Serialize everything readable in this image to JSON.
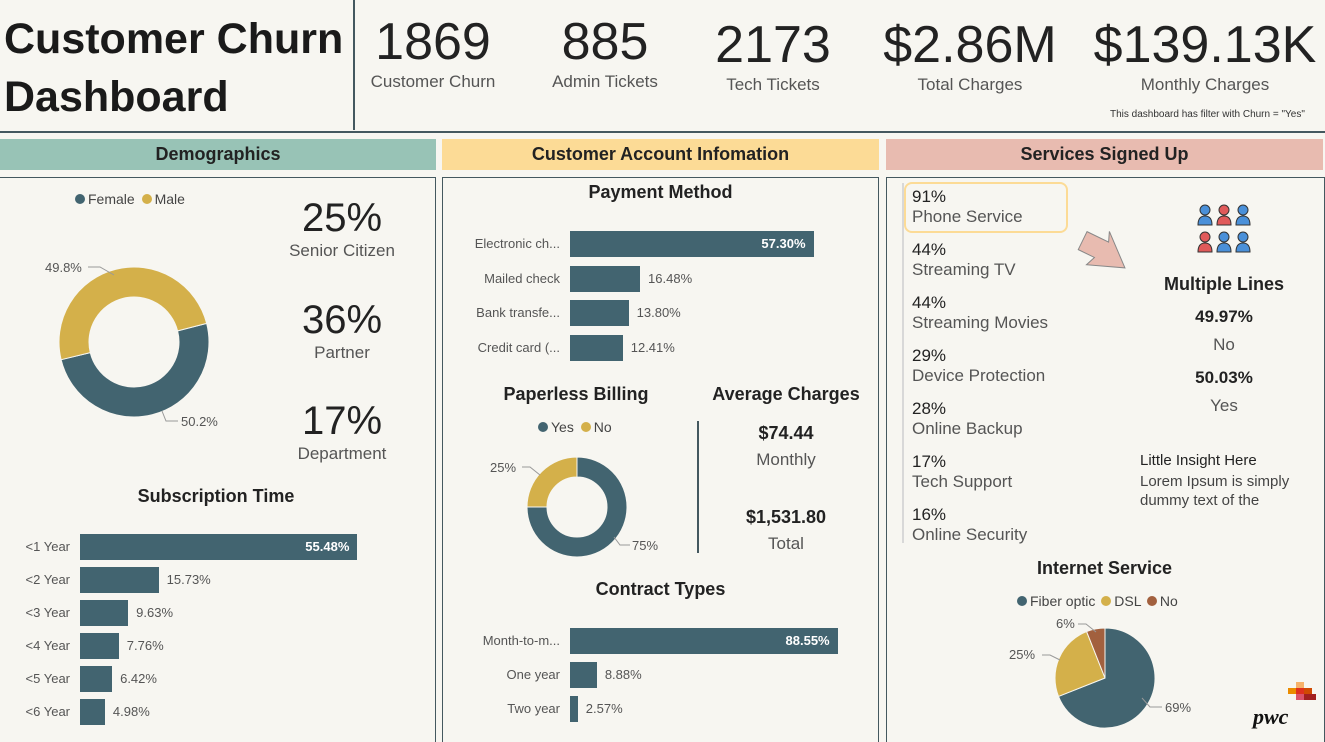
{
  "header": {
    "title_line1": "Customer Churn",
    "title_line2": "Dashboard",
    "kpis": [
      {
        "value": "1869",
        "label": "Customer Churn"
      },
      {
        "value": "885",
        "label": "Admin Tickets"
      },
      {
        "value": "2173",
        "label": "Tech Tickets"
      },
      {
        "value": "$2.86M",
        "label": "Total Charges"
      },
      {
        "value": "$139.13K",
        "label": "Monthly Charges"
      }
    ],
    "filter_note": "This dashboard has filter with Churn = \"Yes\""
  },
  "sections": {
    "demographics": "Demographics",
    "account": "Customer Account Infomation",
    "services": "Services Signed Up"
  },
  "colors": {
    "teal": "#426470",
    "gold": "#d4b04a",
    "brown": "#a2603e",
    "demographics_bg": "#98c3b6",
    "account_bg": "#fcdb96",
    "services_bg": "#e8bbb0"
  },
  "demographics": {
    "legend": [
      "Female",
      "Male"
    ],
    "gender_labels": [
      "49.8%",
      "50.2%"
    ],
    "stats": [
      {
        "value": "25%",
        "label": "Senior Citizen"
      },
      {
        "value": "36%",
        "label": "Partner"
      },
      {
        "value": "17%",
        "label": "Department"
      }
    ],
    "subscription_title": "Subscription Time"
  },
  "account": {
    "payment_title": "Payment Method",
    "paperless_title": "Paperless Billing",
    "paperless_legend": [
      "Yes",
      "No"
    ],
    "paperless_labels": [
      "25%",
      "75%"
    ],
    "avg_title": "Average Charges",
    "avg_monthly": "$74.44",
    "avg_monthly_label": "Monthly",
    "avg_total": "$1,531.80",
    "avg_total_label": "Total",
    "contract_title": "Contract Types"
  },
  "services": {
    "items": [
      {
        "pct": "91%",
        "label": "Phone Service"
      },
      {
        "pct": "44%",
        "label": "Streaming TV"
      },
      {
        "pct": "44%",
        "label": "Streaming Movies"
      },
      {
        "pct": "29%",
        "label": "Device Protection"
      },
      {
        "pct": "28%",
        "label": "Online Backup"
      },
      {
        "pct": "17%",
        "label": "Tech Support"
      },
      {
        "pct": "16%",
        "label": "Online Security"
      }
    ],
    "multiple_lines_title": "Multiple Lines",
    "ml_no_pct": "49.97%",
    "ml_no_label": "No",
    "ml_yes_pct": "50.03%",
    "ml_yes_label": "Yes",
    "insight_title": "Little Insight Here",
    "insight_line1": "Lorem Ipsum is simply",
    "insight_line2": "dummy text of the",
    "internet_title": "Internet Service",
    "internet_legend": [
      "Fiber optic",
      "DSL",
      "No"
    ],
    "internet_labels": [
      "6%",
      "25%",
      "69%"
    ],
    "brand": "pwc"
  },
  "chart_data": [
    {
      "type": "pie",
      "categories": [
        "Female",
        "Male"
      ],
      "values": [
        50.2,
        49.8
      ]
    },
    {
      "type": "bar",
      "title": "Subscription Time",
      "categories": [
        "<1 Year",
        "<2 Year",
        "<3 Year",
        "<4 Year",
        "<5 Year",
        "<6 Year"
      ],
      "values": [
        55.48,
        15.73,
        9.63,
        7.76,
        6.42,
        4.98
      ],
      "labels": [
        "55.48%",
        "15.73%",
        "9.63%",
        "7.76%",
        "6.42%",
        "4.98%"
      ],
      "xlim": [
        0,
        60
      ]
    },
    {
      "type": "bar",
      "title": "Payment Method",
      "categories": [
        "Electronic ch...",
        "Mailed check",
        "Bank transfe...",
        "Credit card (..."
      ],
      "values": [
        57.3,
        16.48,
        13.8,
        12.41
      ],
      "labels": [
        "57.30%",
        "16.48%",
        "13.80%",
        "12.41%"
      ],
      "xlim": [
        0,
        60
      ]
    },
    {
      "type": "pie",
      "title": "Paperless Billing",
      "categories": [
        "Yes",
        "No"
      ],
      "values": [
        75,
        25
      ]
    },
    {
      "type": "bar",
      "title": "Contract Types",
      "categories": [
        "Month-to-m...",
        "One year",
        "Two year"
      ],
      "values": [
        88.55,
        8.88,
        2.57
      ],
      "labels": [
        "88.55%",
        "8.88%",
        "2.57%"
      ],
      "xlim": [
        0,
        90
      ]
    },
    {
      "type": "pie",
      "title": "Internet Service",
      "categories": [
        "Fiber optic",
        "DSL",
        "No"
      ],
      "values": [
        69,
        25,
        6
      ]
    }
  ]
}
